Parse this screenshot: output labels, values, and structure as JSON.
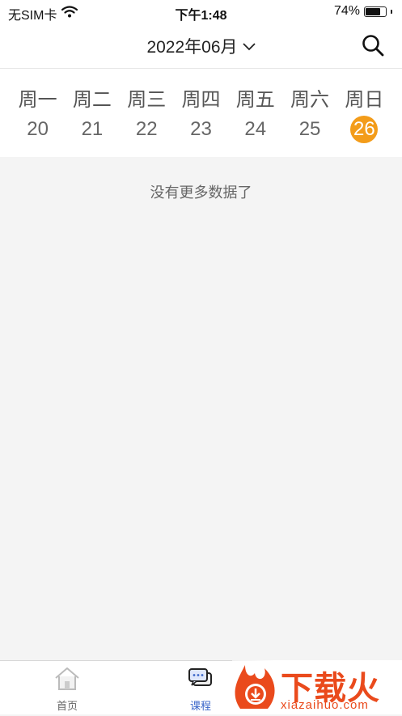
{
  "status_bar": {
    "carrier": "无SIM卡",
    "time": "下午1:48",
    "battery": "74%",
    "battery_level": 0.74
  },
  "header": {
    "month_label": "2022年06月",
    "chevron_icon": "chevron-down-icon",
    "search_icon": "search-icon"
  },
  "week": {
    "days": [
      "周一",
      "周二",
      "周三",
      "周四",
      "周五",
      "周六",
      "周日"
    ],
    "dates": [
      "20",
      "21",
      "22",
      "23",
      "24",
      "25",
      "26"
    ],
    "selected_index": 6,
    "accent_color": "#f39c1a"
  },
  "content": {
    "empty_message": "没有更多数据了"
  },
  "tabbar": {
    "tabs": [
      {
        "label": "首页",
        "icon": "house-icon",
        "active": false
      },
      {
        "label": "课程",
        "icon": "chat-icon",
        "active": true
      }
    ],
    "active_color": "#3a66c9"
  },
  "watermark": {
    "title": "下载火",
    "subtitle": "xiazaihuo.com",
    "brand_color": "#ea4a1c"
  }
}
